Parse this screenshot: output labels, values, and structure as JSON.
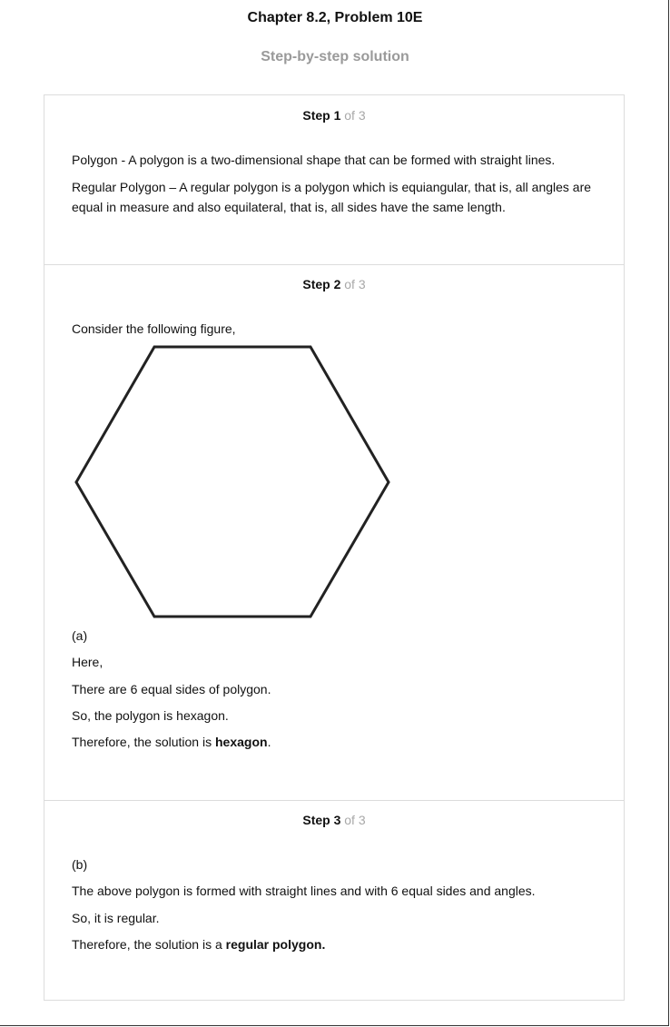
{
  "header": {
    "title": "Chapter 8.2, Problem 10E",
    "subtitle": "Step-by-step solution"
  },
  "steps": [
    {
      "label": "Step 1",
      "of": "of 3",
      "paragraphs": [
        "Polygon - A polygon is a two-dimensional shape that can be formed with straight lines.",
        "Regular Polygon – A regular polygon is a polygon which is equiangular, that is, all angles are equal in measure and also equilateral, that is, all sides have the same length."
      ]
    },
    {
      "label": "Step 2",
      "of": "of 3",
      "intro": "Consider the following figure,",
      "figure_icon": "hexagon-figure",
      "paragraphs": [
        "(a)",
        "Here,",
        "There are 6 equal sides of polygon.",
        "So, the polygon is hexagon."
      ],
      "conclusion_prefix": "Therefore, the solution is ",
      "conclusion_bold": "hexagon",
      "conclusion_suffix": "."
    },
    {
      "label": "Step 3",
      "of": "of 3",
      "paragraphs": [
        "(b)",
        "The above polygon is formed with straight lines and with 6 equal sides and angles.",
        "So, it is regular."
      ],
      "conclusion_prefix": "Therefore, the solution is a ",
      "conclusion_bold": "regular polygon."
    }
  ]
}
